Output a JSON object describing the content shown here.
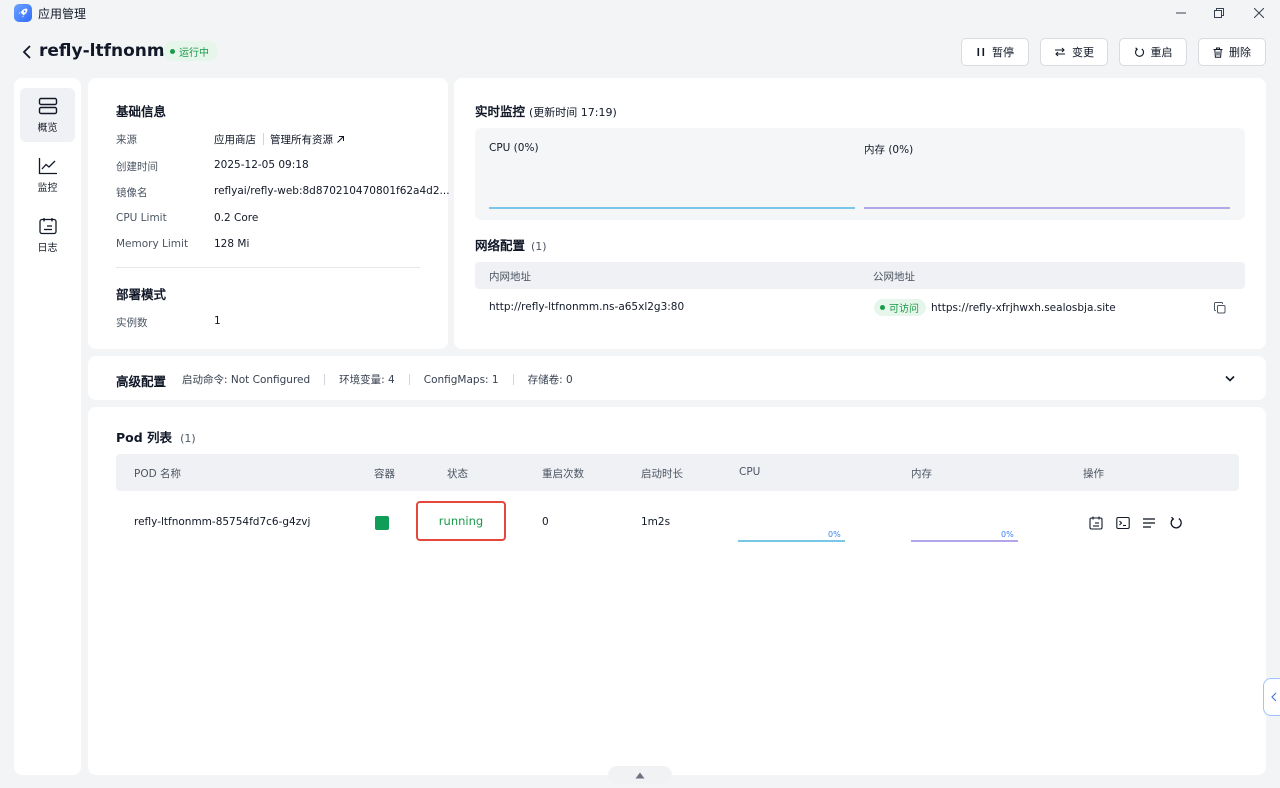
{
  "window": {
    "title": "应用管理",
    "icon": "rocket-icon"
  },
  "header": {
    "app_name": "refly-ltfnonmm",
    "status": "运行中",
    "buttons": {
      "pause": "暂停",
      "change": "变更",
      "restart": "重启",
      "delete": "删除"
    }
  },
  "sidebar": {
    "items": [
      {
        "label": "概览",
        "icon": "overview-icon",
        "active": true
      },
      {
        "label": "监控",
        "icon": "monitor-chart-icon",
        "active": false
      },
      {
        "label": "日志",
        "icon": "log-icon",
        "active": false
      }
    ]
  },
  "basic_info": {
    "title": "基础信息",
    "source_label": "来源",
    "source_value": "应用商店",
    "manage_link": "管理所有资源",
    "created_label": "创建时间",
    "created_value": "2025-12-05 09:18",
    "image_label": "镜像名",
    "image_value": "reflyai/refly-web:8d870210470801f62a4d2...",
    "cpu_limit_label": "CPU Limit",
    "cpu_limit_value": "0.2 Core",
    "memory_limit_label": "Memory Limit",
    "memory_limit_value": "128 Mi",
    "deploy_title": "部署模式",
    "instances_label": "实例数",
    "instances_value": "1"
  },
  "monitor": {
    "title": "实时监控",
    "update_time": "(更新时间  17:19)",
    "cpu_label": "CPU  (0%)",
    "mem_label": "内存  (0%)",
    "cpu_color": "#79c7e6",
    "mem_color": "#b3a6e8"
  },
  "network": {
    "title": "网络配置",
    "count": "(1)",
    "internal_header": "内网地址",
    "public_header": "公网地址",
    "internal_value": "http://refly-ltfnonmm.ns-a65xl2g3:80",
    "public_status": "可访问",
    "public_value": "https://refly-xfrjhwxh.sealosbja.site"
  },
  "advanced": {
    "title": "高级配置",
    "startup": "启动命令: Not Configured",
    "env": "环境变量: 4",
    "configmaps": "ConfigMaps: 1",
    "storage": "存储卷: 0"
  },
  "pods": {
    "title": "Pod 列表",
    "count": "(1)",
    "headers": [
      "POD 名称",
      "容器",
      "状态",
      "重启次数",
      "启动时长",
      "CPU",
      "内存",
      "操作"
    ],
    "rows": [
      {
        "name": "refly-ltfnonmm-85754fd7c6-g4zvj",
        "status": "running",
        "restarts": "0",
        "uptime": "1m2s",
        "cpu": "0%",
        "mem": "0%"
      }
    ]
  },
  "colors": {
    "green": "#1a9a4a",
    "container_green": "#0f9d58",
    "highlight_red": "#e5483b"
  }
}
